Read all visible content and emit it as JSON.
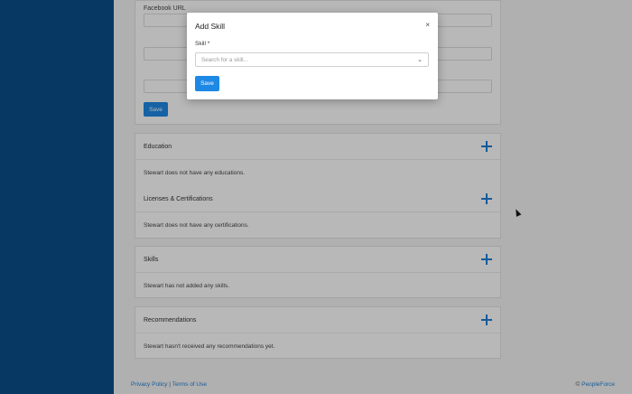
{
  "form": {
    "facebook_label": "Facebook URL",
    "save_label": "Save"
  },
  "sections": [
    {
      "title": "Education",
      "empty_text": "Stewart does not have any educations."
    },
    {
      "title": "Licenses & Certifications",
      "empty_text": "Stewart does not have any certifications."
    },
    {
      "title": "Skills",
      "empty_text": "Stewart has not added any skills."
    },
    {
      "title": "Recommendations",
      "empty_text": "Stewart hasn't received any recommendations yet."
    }
  ],
  "footer": {
    "privacy": "Privacy Policy",
    "separator": "|",
    "terms": "Terms of Use",
    "copyright_symbol": "©",
    "brand": "PeopleForce"
  },
  "modal": {
    "title": "Add Skill",
    "close": "×",
    "skill_label": "Skill *",
    "skill_placeholder": "Search for a skill...",
    "save_label": "Save"
  },
  "colors": {
    "sidebar": "#0b4e8a",
    "primary": "#1e88e5"
  }
}
